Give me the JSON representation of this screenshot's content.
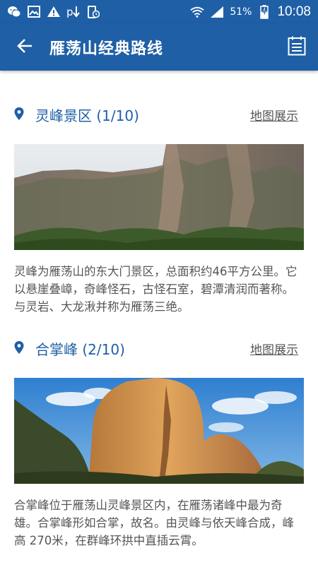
{
  "status_bar": {
    "battery_percent": "51%",
    "time": "10:08",
    "icons": [
      "wechat-icon",
      "image-icon",
      "warning-icon",
      "download-icon",
      "phone-clock-icon",
      "wifi-icon",
      "signal-icon",
      "battery-charging-icon"
    ]
  },
  "app_bar": {
    "title": "雁荡山经典路线",
    "back_icon": "arrow-left-icon",
    "menu_icon": "calendar-list-icon"
  },
  "spots": [
    {
      "title": "灵峰景区 (1/10)",
      "map_label": "地图展示",
      "description": "灵峰为雁荡山的东大门景区，总面积约46平方公里。它以悬崖叠嶂，奇峰怪石，古怪石室，碧潭清润而著称。与灵岩、大龙湫并称为雁荡三绝。",
      "image": "cliff-landscape-photo"
    },
    {
      "title": "合掌峰 (2/10)",
      "map_label": "地图展示",
      "description": "合掌峰位于雁荡山灵峰景区内，在雁荡诸峰中最为奇雄。合掌峰形如合掌，故名。由灵峰与依天峰合成，峰高 270米，在群峰环拱中直插云霄。",
      "image": "rock-peak-photo"
    }
  ],
  "colors": {
    "primary": "#1f5fa6",
    "text_secondary": "#555555"
  }
}
